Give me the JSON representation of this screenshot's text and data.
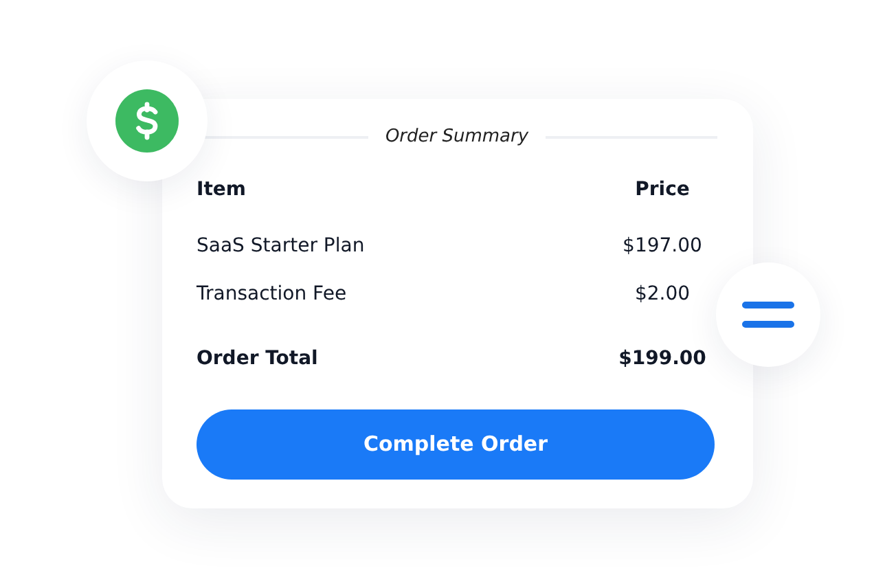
{
  "title": "Order Summary",
  "columns": [
    "Item",
    "Price"
  ],
  "items": [
    {
      "name": "SaaS Starter Plan",
      "price": "$197.00"
    },
    {
      "name": "Transaction Fee",
      "price": "$2.00"
    }
  ],
  "total": {
    "label": "Order Total",
    "price": "$199.00"
  },
  "button": "Complete Order"
}
